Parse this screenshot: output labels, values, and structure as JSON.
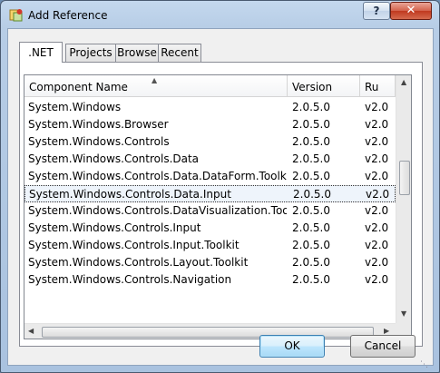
{
  "window": {
    "title": "Add Reference",
    "help_label": "?",
    "close_label": "✕"
  },
  "tabs": [
    {
      "label": ".NET",
      "active": true
    },
    {
      "label": "Projects",
      "active": false
    },
    {
      "label": "Browse",
      "active": false
    },
    {
      "label": "Recent",
      "active": false
    }
  ],
  "list": {
    "columns": [
      "Component Name",
      "Version",
      "Ru"
    ],
    "sorted_column": "Component Name",
    "rows": [
      {
        "name": "System.Windows",
        "version": "2.0.5.0",
        "runtime": "v2.0"
      },
      {
        "name": "System.Windows.Browser",
        "version": "2.0.5.0",
        "runtime": "v2.0"
      },
      {
        "name": "System.Windows.Controls",
        "version": "2.0.5.0",
        "runtime": "v2.0"
      },
      {
        "name": "System.Windows.Controls.Data",
        "version": "2.0.5.0",
        "runtime": "v2.0"
      },
      {
        "name": "System.Windows.Controls.Data.DataForm.Toolkit",
        "version": "2.0.5.0",
        "runtime": "v2.0"
      },
      {
        "name": "System.Windows.Controls.Data.Input",
        "version": "2.0.5.0",
        "runtime": "v2.0"
      },
      {
        "name": "System.Windows.Controls.DataVisualization.Toolkit",
        "version": "2.0.5.0",
        "runtime": "v2.0"
      },
      {
        "name": "System.Windows.Controls.Input",
        "version": "2.0.5.0",
        "runtime": "v2.0"
      },
      {
        "name": "System.Windows.Controls.Input.Toolkit",
        "version": "2.0.5.0",
        "runtime": "v2.0"
      },
      {
        "name": "System.Windows.Controls.Layout.Toolkit",
        "version": "2.0.5.0",
        "runtime": "v2.0"
      },
      {
        "name": "System.Windows.Controls.Navigation",
        "version": "2.0.5.0",
        "runtime": "v2.0"
      }
    ],
    "selected_index": 5
  },
  "buttons": {
    "ok_label": "OK",
    "cancel_label": "Cancel"
  },
  "icons": {
    "app": "add-reference-icon",
    "sort": "sort-ascending-icon",
    "scroll_up": "scroll-up-icon",
    "scroll_down": "scroll-down-icon",
    "scroll_left": "scroll-left-icon",
    "scroll_right": "scroll-right-icon"
  }
}
